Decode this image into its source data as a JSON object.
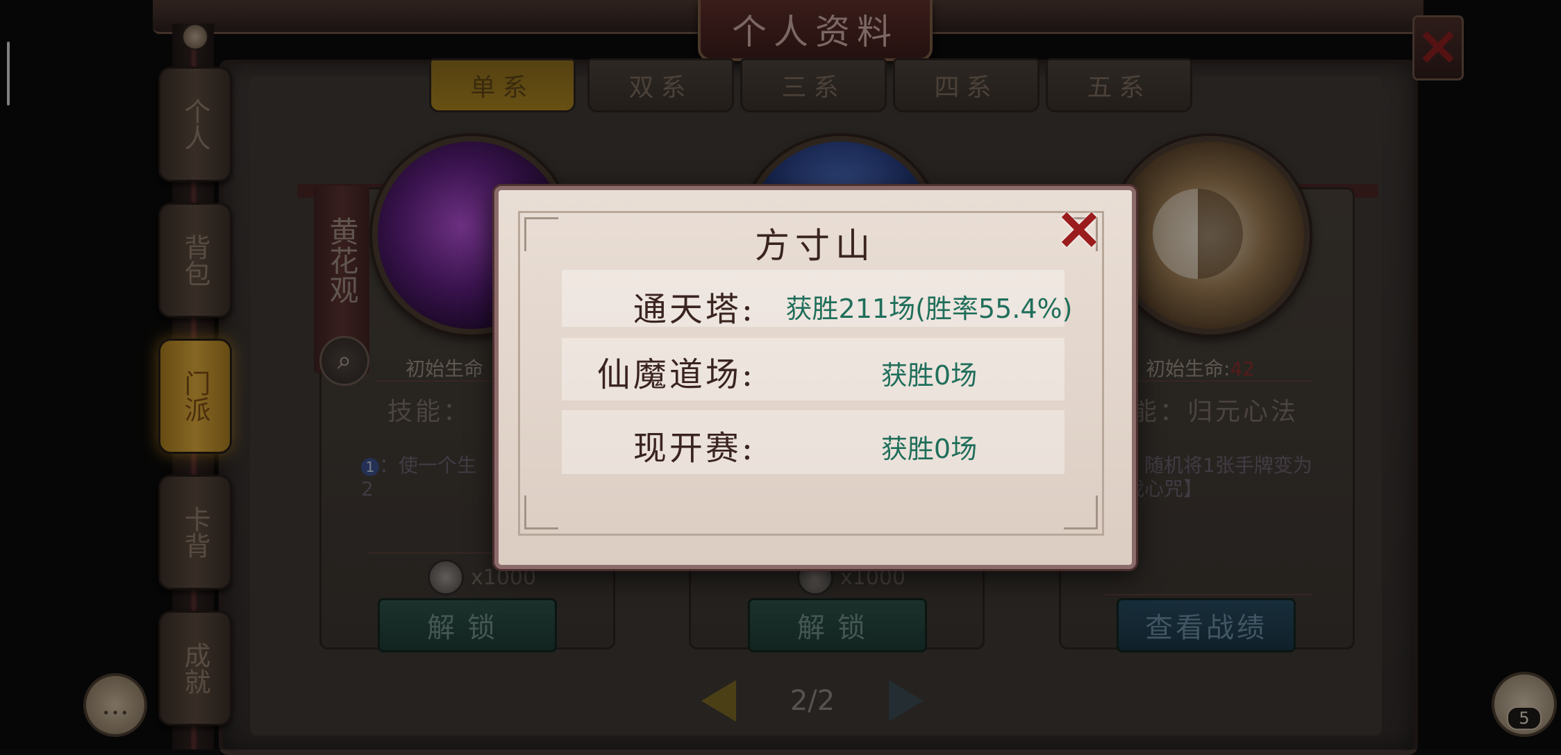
{
  "window": {
    "title": "个人资料",
    "close_icon": "close-x-icon"
  },
  "side_tabs": [
    {
      "label": "个人",
      "active": false
    },
    {
      "label": "背包",
      "active": false
    },
    {
      "label": "门派",
      "active": true
    },
    {
      "label": "卡背",
      "active": false
    },
    {
      "label": "成就",
      "active": false
    }
  ],
  "top_tabs": [
    {
      "label": "单系",
      "active": true
    },
    {
      "label": "双系",
      "active": false
    },
    {
      "label": "三系",
      "active": false
    },
    {
      "label": "四系",
      "active": false
    },
    {
      "label": "五系",
      "active": false
    }
  ],
  "sect_label": "黄花观",
  "cards": [
    {
      "hp_label": "初始生命",
      "skill_label": "技能：",
      "desc": "：使一个生",
      "desc2": "2",
      "cost": "x1000",
      "button": "解锁"
    },
    {
      "cost": "x1000",
      "button": "解锁"
    },
    {
      "hp_label": "初始生命",
      "hp_value": "42",
      "skill_label": "能：归元心法",
      "desc": "：随机将1张手牌变为",
      "desc2": "戕心咒】",
      "button": "查看战绩"
    }
  ],
  "pager": {
    "current": "2/2"
  },
  "friends": {
    "count": "5"
  },
  "modal": {
    "title": "方寸山",
    "rows": [
      {
        "label": "通天塔:",
        "value": "获胜211场(胜率55.4%)"
      },
      {
        "label": "仙魔道场:",
        "value": "获胜0场"
      },
      {
        "label": "现开赛:",
        "value": "获胜0场"
      }
    ]
  },
  "colors": {
    "win_text": "#1f6e5a",
    "hp_value": "#8a2c2c",
    "close_red": "#9b1c1c",
    "active_tab_gold": "#d8a63a"
  }
}
